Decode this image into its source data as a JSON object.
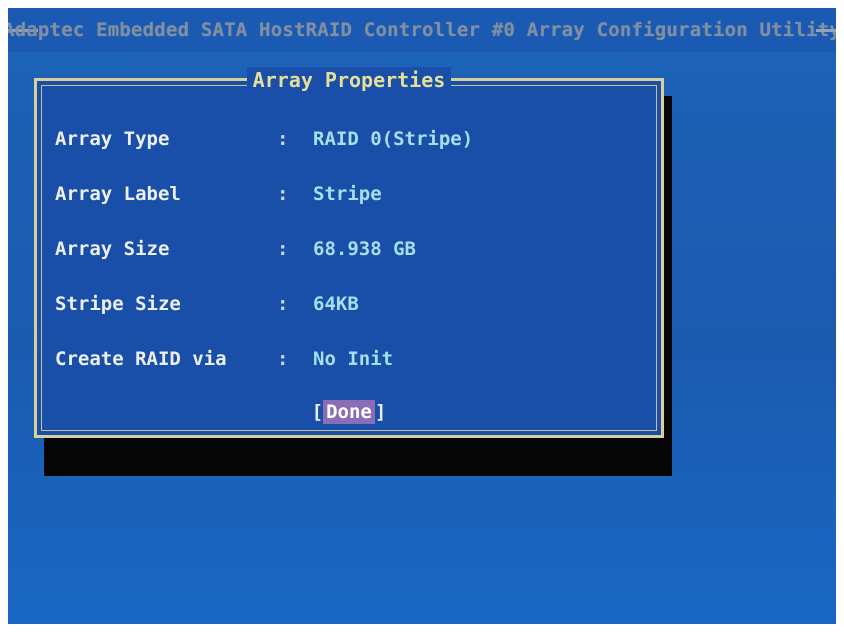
{
  "window": {
    "title": "Adaptec Embedded SATA HostRAID Controller #0 Array Configuration Utility"
  },
  "dialog": {
    "title": "Array Properties",
    "separator": ":",
    "fields": [
      {
        "label": "Array Type",
        "value": "RAID 0(Stripe)"
      },
      {
        "label": "Array Label",
        "value": "Stripe"
      },
      {
        "label": "Array Size",
        "value": "68.938 GB"
      },
      {
        "label": "Stripe Size",
        "value": "64KB"
      },
      {
        "label": "Create RAID via",
        "value": "No Init"
      }
    ],
    "done_button": {
      "left_bracket": "[",
      "label": "Done",
      "right_bracket": "]"
    }
  },
  "colors": {
    "screen_background": "#1d63b7",
    "dialog_background": "#194fa8",
    "dialog_border": "#d8cf9a",
    "dialog_title": "#e6df9a",
    "value_text": "#a7dff1",
    "selection_highlight": "#8a6db5"
  }
}
